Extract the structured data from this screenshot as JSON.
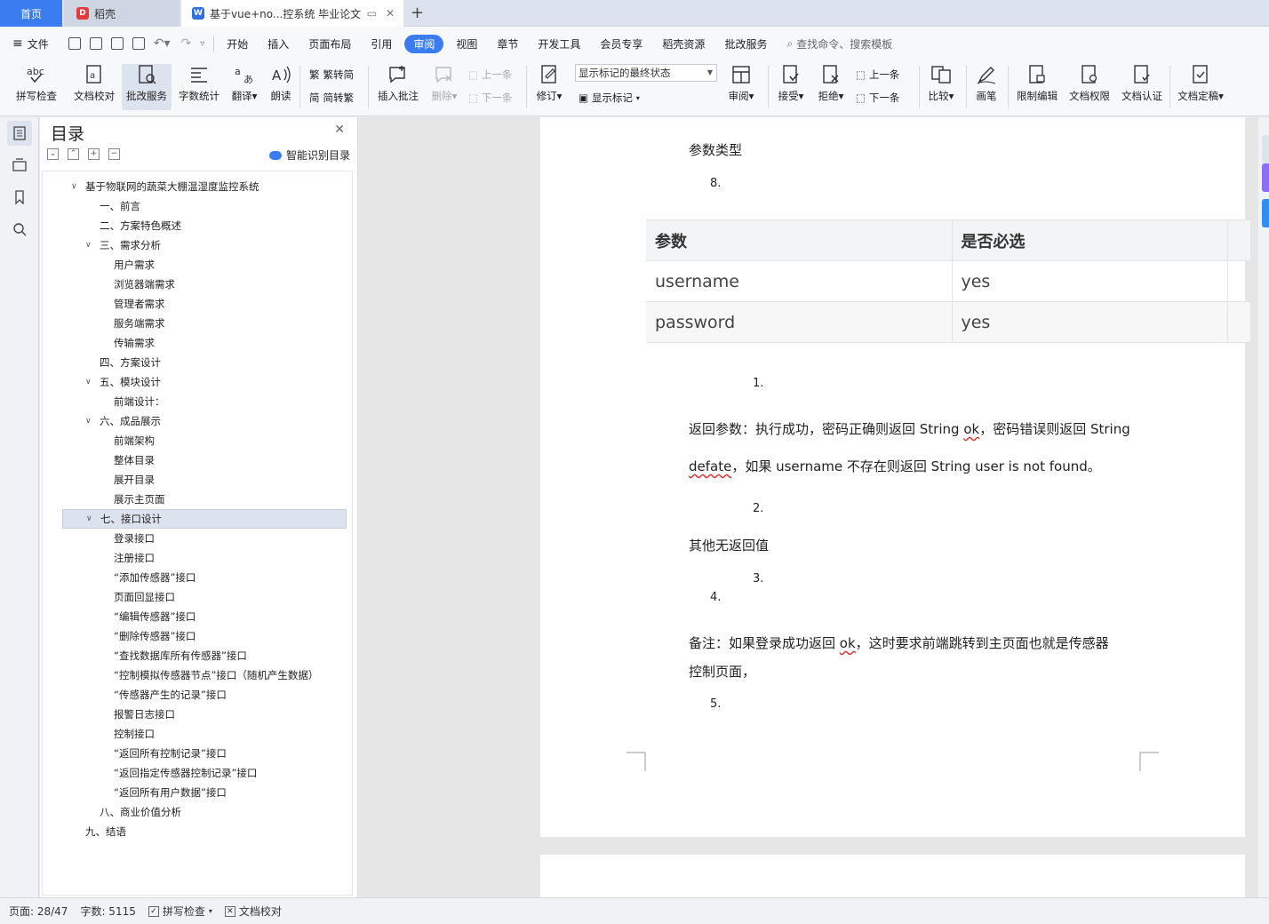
{
  "tabs": {
    "home": "首页",
    "daoke": "稻壳",
    "doc": "基于vue+no...控系统 毕业论文"
  },
  "menu": {
    "file": "文件",
    "items": [
      "开始",
      "插入",
      "页面布局",
      "引用",
      "审阅",
      "视图",
      "章节",
      "开发工具",
      "会员专享",
      "稻壳资源",
      "批改服务"
    ],
    "search_placeholder": "查找命令、搜索模板"
  },
  "ribbon": {
    "spell_check": "拼写检查",
    "doc_proof": "文档校对",
    "correction_service": "批改服务",
    "word_count": "字数统计",
    "translate": "翻译",
    "read_aloud": "朗读",
    "trad_to_simp": "繁转简",
    "simp_to_trad": "简转繁",
    "insert_comment": "插入批注",
    "delete": "删除",
    "prev_comment": "上一条",
    "next_comment": "下一条",
    "revise": "修订",
    "markup_state": "显示标记的最终状态",
    "show_markup": "显示标记",
    "review": "审阅",
    "accept": "接受",
    "reject": "拒绝",
    "prev_change": "上一条",
    "next_change": "下一条",
    "compare": "比较",
    "pen": "画笔",
    "restrict_edit": "限制编辑",
    "doc_permission": "文档权限",
    "doc_certify": "文档认证",
    "doc_finalize": "文档定稿"
  },
  "toc": {
    "title": "目录",
    "smart_label": "智能识别目录",
    "items": [
      {
        "text": "基于物联网的蔬菜大棚温湿度监控系统",
        "level": 0,
        "expanded": true
      },
      {
        "text": "一、前言",
        "level": 1
      },
      {
        "text": "二、方案特色概述",
        "level": 1
      },
      {
        "text": "三、需求分析",
        "level": 1,
        "expanded": true
      },
      {
        "text": "用户需求",
        "level": 2
      },
      {
        "text": "浏览器端需求",
        "level": 2
      },
      {
        "text": "管理者需求",
        "level": 2
      },
      {
        "text": "服务端需求",
        "level": 2
      },
      {
        "text": "传输需求",
        "level": 2
      },
      {
        "text": "四、方案设计",
        "level": 1
      },
      {
        "text": "五、模块设计",
        "level": 1,
        "expanded": true
      },
      {
        "text": "前端设计：",
        "level": 2
      },
      {
        "text": "六、成品展示",
        "level": 1,
        "expanded": true
      },
      {
        "text": "前端架构",
        "level": 2
      },
      {
        "text": "整体目录",
        "level": 2
      },
      {
        "text": "展开目录",
        "level": 2
      },
      {
        "text": "展示主页面",
        "level": 2
      },
      {
        "text": "七、接口设计",
        "level": 1,
        "expanded": true,
        "selected": true
      },
      {
        "text": "登录接口",
        "level": 2
      },
      {
        "text": "注册接口",
        "level": 2
      },
      {
        "text": "“添加传感器”接口",
        "level": 2
      },
      {
        "text": "页面回显接口",
        "level": 2
      },
      {
        "text": "“编辑传感器”接口",
        "level": 2
      },
      {
        "text": "“删除传感器”接口",
        "level": 2
      },
      {
        "text": "“查找数据库所有传感器”接口",
        "level": 2
      },
      {
        "text": "“控制模拟传感器节点”接口（随机产生数据）",
        "level": 2
      },
      {
        "text": "“传感器产生的记录”接口",
        "level": 2
      },
      {
        "text": "报警日志接口",
        "level": 2
      },
      {
        "text": "控制接口",
        "level": 2
      },
      {
        "text": "“返回所有控制记录”接口",
        "level": 2
      },
      {
        "text": "“返回指定传感器控制记录”接口",
        "level": 2
      },
      {
        "text": "“返回所有用户数据”接口",
        "level": 2
      },
      {
        "text": "八、商业价值分析",
        "level": 1
      },
      {
        "text": "九、结语",
        "level": 0
      }
    ]
  },
  "document": {
    "param_type": "参数类型",
    "n8": "8.",
    "table": {
      "headers": [
        "参数",
        "是否必选"
      ],
      "rows": [
        [
          "username",
          "yes"
        ],
        [
          "password",
          "yes"
        ]
      ]
    },
    "n1": "1.",
    "return_line1_a": "返回参数：执行成功，密码正确则返回  String ",
    "return_line1_ok": "ok",
    "return_line1_b": "，密码错误则返回  String",
    "return_line2_defate": "defate",
    "return_line2_b": "，如果  username  不存在则返回  String user is not found。",
    "n2": "2.",
    "no_return": "其他无返回值",
    "n3": "3.",
    "n4": "4.",
    "note_a": "备注：如果登录成功返回  ",
    "note_ok": "ok",
    "note_b": "，这时要求前端跳转到主页面也就是传感器",
    "note_line2": "控制页面，",
    "n5": "5."
  },
  "status": {
    "page": "页面: 28/47",
    "words": "字数: 5115",
    "spell_check": "拼写检查",
    "doc_proof": "文档校对"
  },
  "colors": {
    "accent": "#3b7cf0",
    "selected_bg": "#dde3ee"
  }
}
